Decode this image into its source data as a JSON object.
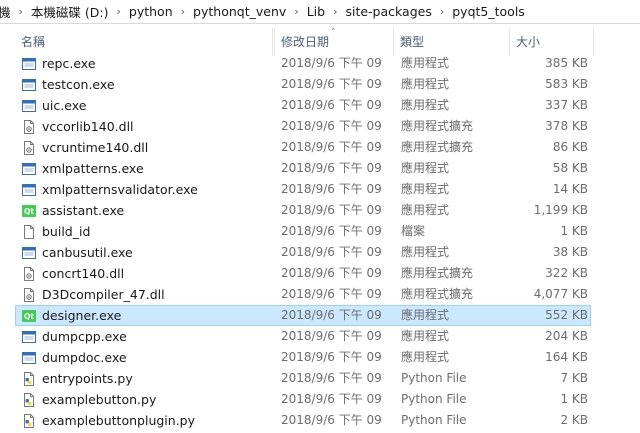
{
  "breadcrumb": [
    "機",
    "本機磁碟 (D:)",
    "python",
    "pythonqt_venv",
    "Lib",
    "site-packages",
    "pyqt5_tools"
  ],
  "columns": {
    "name": "名稱",
    "date": "修改日期",
    "type": "類型",
    "size": "大小"
  },
  "files": [
    {
      "name": "repc.exe",
      "date": "2018/9/6 下午 09",
      "type": "應用程式",
      "size": "385 KB",
      "icon": "exe"
    },
    {
      "name": "testcon.exe",
      "date": "2018/9/6 下午 09",
      "type": "應用程式",
      "size": "583 KB",
      "icon": "exe"
    },
    {
      "name": "uic.exe",
      "date": "2018/9/6 下午 09",
      "type": "應用程式",
      "size": "337 KB",
      "icon": "exe"
    },
    {
      "name": "vccorlib140.dll",
      "date": "2018/9/6 下午 09",
      "type": "應用程式擴充",
      "size": "378 KB",
      "icon": "dll"
    },
    {
      "name": "vcruntime140.dll",
      "date": "2018/9/6 下午 09",
      "type": "應用程式擴充",
      "size": "86 KB",
      "icon": "dll"
    },
    {
      "name": "xmlpatterns.exe",
      "date": "2018/9/6 下午 09",
      "type": "應用程式",
      "size": "58 KB",
      "icon": "exe"
    },
    {
      "name": "xmlpatternsvalidator.exe",
      "date": "2018/9/6 下午 09",
      "type": "應用程式",
      "size": "14 KB",
      "icon": "exe"
    },
    {
      "name": "assistant.exe",
      "date": "2018/9/6 下午 09",
      "type": "應用程式",
      "size": "1,199 KB",
      "icon": "qt"
    },
    {
      "name": "build_id",
      "date": "2018/9/6 下午 09",
      "type": "檔案",
      "size": "1 KB",
      "icon": "file"
    },
    {
      "name": "canbusutil.exe",
      "date": "2018/9/6 下午 09",
      "type": "應用程式",
      "size": "38 KB",
      "icon": "exe"
    },
    {
      "name": "concrt140.dll",
      "date": "2018/9/6 下午 09",
      "type": "應用程式擴充",
      "size": "322 KB",
      "icon": "dll"
    },
    {
      "name": "D3Dcompiler_47.dll",
      "date": "2018/9/6 下午 09",
      "type": "應用程式擴充",
      "size": "4,077 KB",
      "icon": "dll"
    },
    {
      "name": "designer.exe",
      "date": "2018/9/6 下午 09",
      "type": "應用程式",
      "size": "552 KB",
      "icon": "qt",
      "selected": true
    },
    {
      "name": "dumpcpp.exe",
      "date": "2018/9/6 下午 09",
      "type": "應用程式",
      "size": "204 KB",
      "icon": "exe"
    },
    {
      "name": "dumpdoc.exe",
      "date": "2018/9/6 下午 09",
      "type": "應用程式",
      "size": "164 KB",
      "icon": "exe"
    },
    {
      "name": "entrypoints.py",
      "date": "2018/9/6 下午 09",
      "type": "Python File",
      "size": "7 KB",
      "icon": "py"
    },
    {
      "name": "examplebutton.py",
      "date": "2018/9/6 下午 09",
      "type": "Python File",
      "size": "1 KB",
      "icon": "py"
    },
    {
      "name": "examplebuttonplugin.py",
      "date": "2018/9/6 下午 09",
      "type": "Python File",
      "size": "2 KB",
      "icon": "py"
    }
  ],
  "colors": {
    "selection_bg": "#cce8ff",
    "selection_border": "#99d1ff",
    "header_text": "#4c607a",
    "detail_text": "#6d6d6d"
  }
}
